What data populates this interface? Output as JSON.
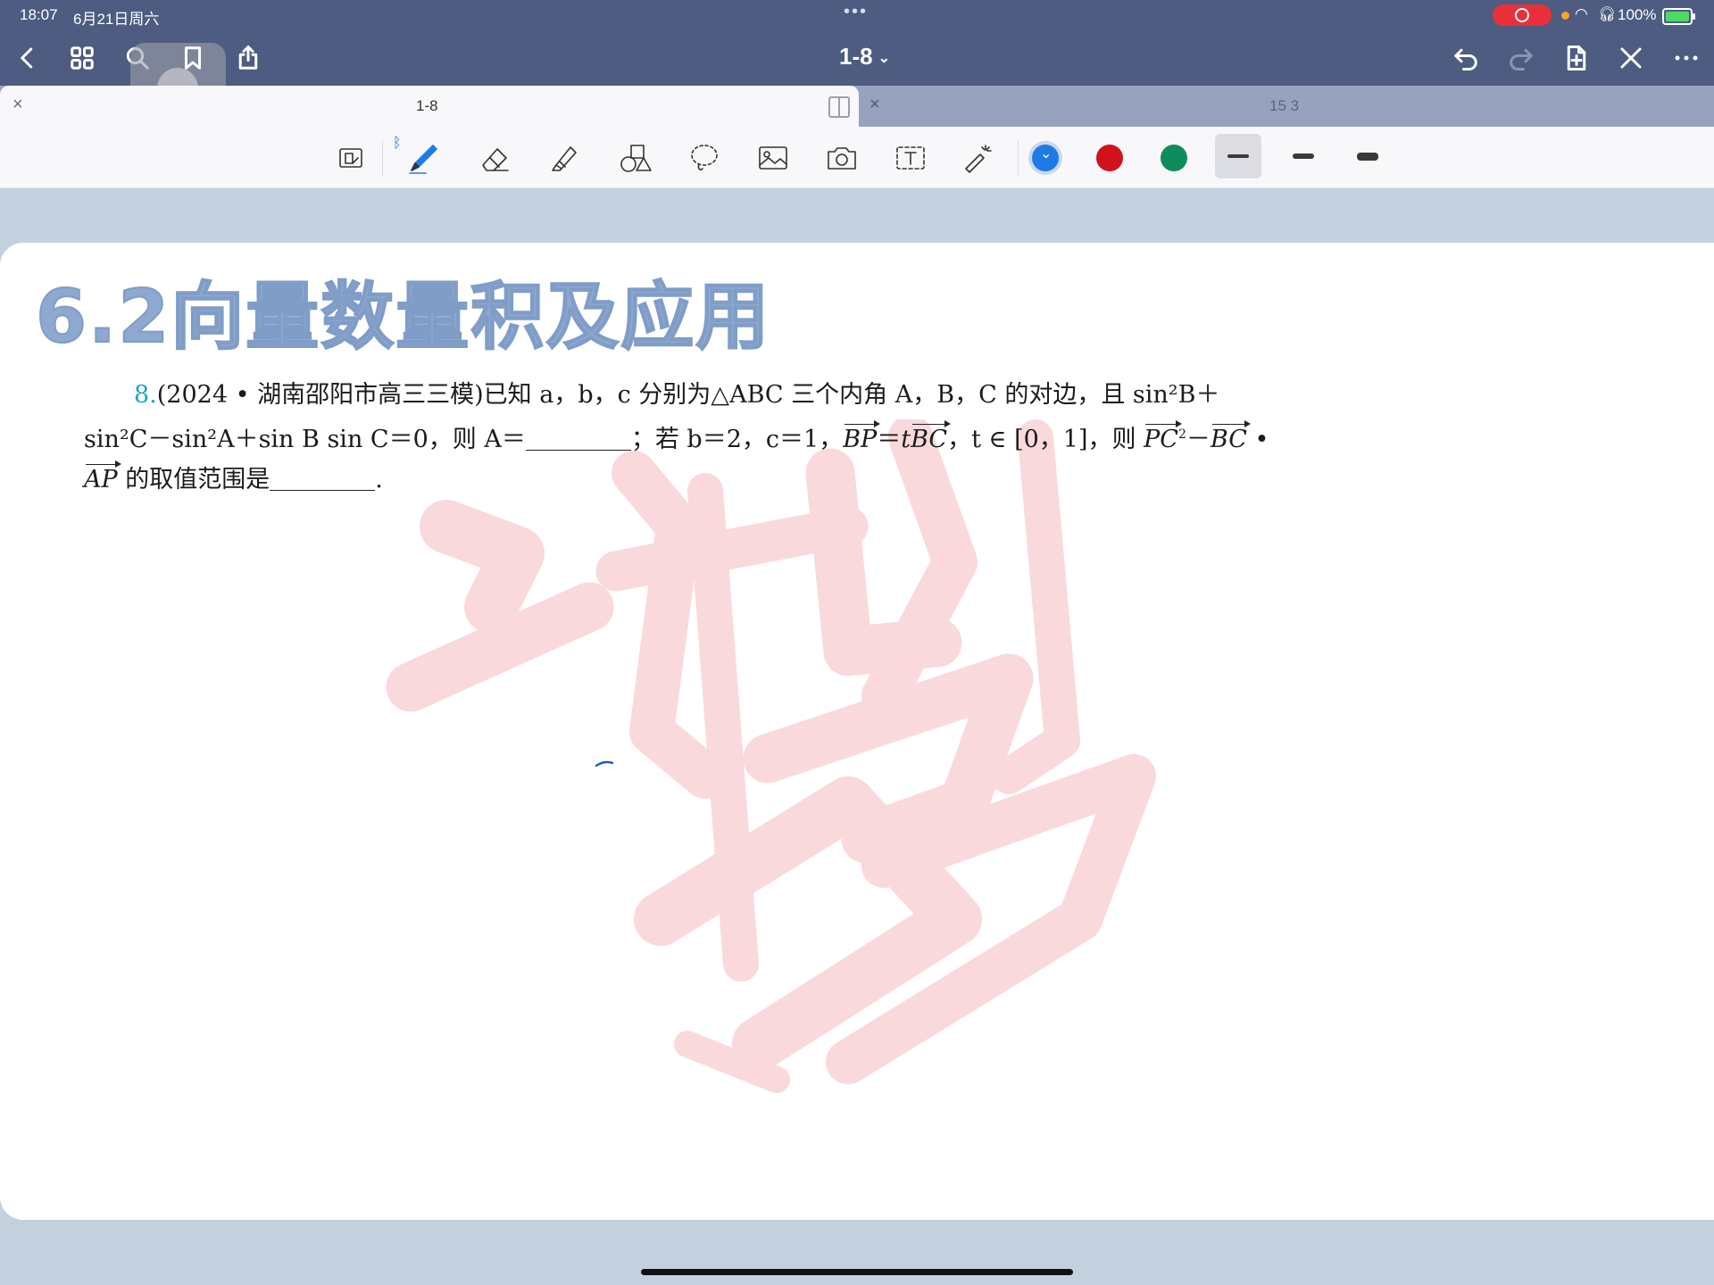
{
  "status": {
    "time": "18:07",
    "date": "6月21日周六",
    "battery": "100%"
  },
  "nav": {
    "title": "1-8"
  },
  "tabs": [
    {
      "label": "1-8",
      "active": true
    },
    {
      "label": "15 3",
      "active": false
    }
  ],
  "toolbar": {
    "colors": [
      "#1e7be6",
      "#d0121b",
      "#0f8c5b"
    ]
  },
  "document": {
    "heading": "6.2向量数量积及应用",
    "question": {
      "number": "8.",
      "source": "(2024 • 湖南邵阳市高三三模)",
      "line1": "已知 a，b，c 分别为△ABC 三个内角 A，B，C 的对边，且 sin²B＋",
      "line2_a": "sin²C－sin²A＋sin B sin C＝0，则 A＝",
      "line2_b": "；若 b＝2，c＝1，",
      "line2_c": "，t ∈ [0，1]，则",
      "line3": "的取值范围是"
    }
  }
}
